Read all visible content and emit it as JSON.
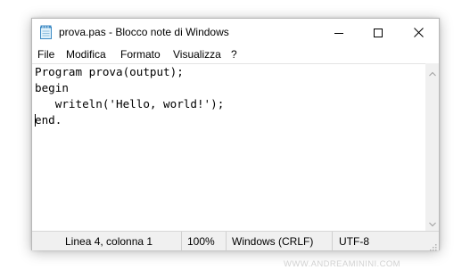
{
  "window": {
    "title": "prova.pas - Blocco note di Windows",
    "icon": "notepad-icon"
  },
  "title_buttons": {
    "minimize_icon": "minimize-icon",
    "maximize_icon": "maximize-icon",
    "close_icon": "close-icon"
  },
  "menu": {
    "items": [
      {
        "label": "File"
      },
      {
        "label": "Modifica"
      },
      {
        "label": "Formato"
      },
      {
        "label": "Visualizza"
      },
      {
        "label": "?"
      }
    ]
  },
  "editor": {
    "lines": [
      "Program prova(output);",
      "begin",
      "   writeln('Hello, world!');",
      "end."
    ],
    "caret_line": 4,
    "caret_column": 1
  },
  "status": {
    "position": "Linea 4, colonna 1",
    "zoom": "100%",
    "line_ending": "Windows (CRLF)",
    "encoding": "UTF-8"
  },
  "watermark": "WWW.ANDREAMININI.COM",
  "colors": {
    "status_bg": "#f0f0f0",
    "scrollbar_bg": "#f0f0f0",
    "watermark": "#d2d2d2"
  }
}
